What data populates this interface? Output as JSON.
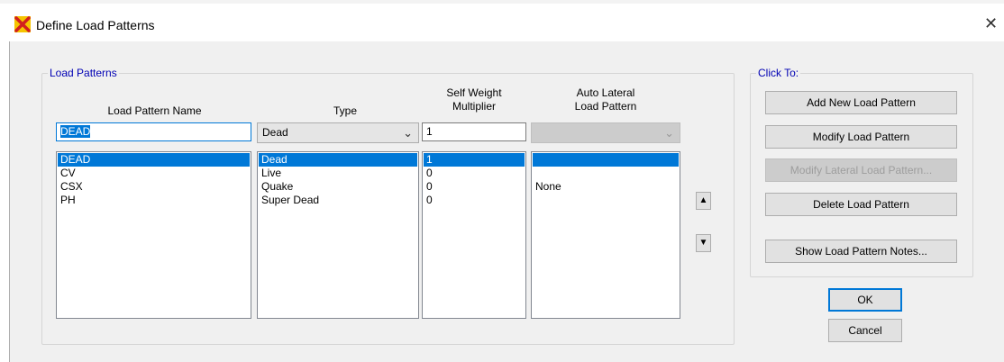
{
  "window": {
    "title": "Define Load Patterns",
    "close_icon": "✕"
  },
  "load_patterns": {
    "group_label": "Load Patterns",
    "headers": {
      "name": "Load Pattern Name",
      "type": "Type",
      "self_weight_line1": "Self Weight",
      "self_weight_line2": "Multiplier",
      "auto_lateral_line1": "Auto Lateral",
      "auto_lateral_line2": "Load Pattern"
    },
    "edit_row": {
      "name": "DEAD",
      "type": "Dead",
      "multiplier": "1",
      "auto_lateral": ""
    },
    "rows": [
      {
        "name": "DEAD",
        "type": "Dead",
        "multiplier": "1",
        "auto_lateral": "",
        "selected": true
      },
      {
        "name": "CV",
        "type": "Live",
        "multiplier": "0",
        "auto_lateral": ""
      },
      {
        "name": "CSX",
        "type": "Quake",
        "multiplier": "0",
        "auto_lateral": "None"
      },
      {
        "name": "PH",
        "type": "Super Dead",
        "multiplier": "0",
        "auto_lateral": ""
      }
    ],
    "move_up_icon": "▲",
    "move_down_icon": "▼"
  },
  "click_to": {
    "group_label": "Click To:",
    "add_label": "Add New Load Pattern",
    "modify_label": "Modify Load Pattern",
    "modify_lateral_label": "Modify Lateral Load Pattern...",
    "delete_label": "Delete Load Pattern",
    "notes_label": "Show Load Pattern Notes..."
  },
  "ok_label": "OK",
  "cancel_label": "Cancel"
}
